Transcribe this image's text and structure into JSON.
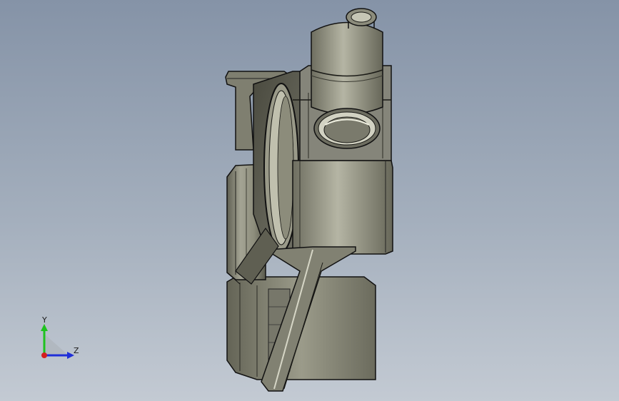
{
  "viewport": {
    "background_top": "#8593a7",
    "background_bottom": "#c3cad3"
  },
  "model": {
    "name_icon": "mechanical-part-3d",
    "body_color": "#8a8a7a",
    "edge_color": "#101010"
  },
  "triad": {
    "y_label": "Y",
    "z_label": "Z",
    "y_color": "#1fc21f",
    "z_color": "#1f2fd8",
    "x_color": "#d41f1f"
  }
}
